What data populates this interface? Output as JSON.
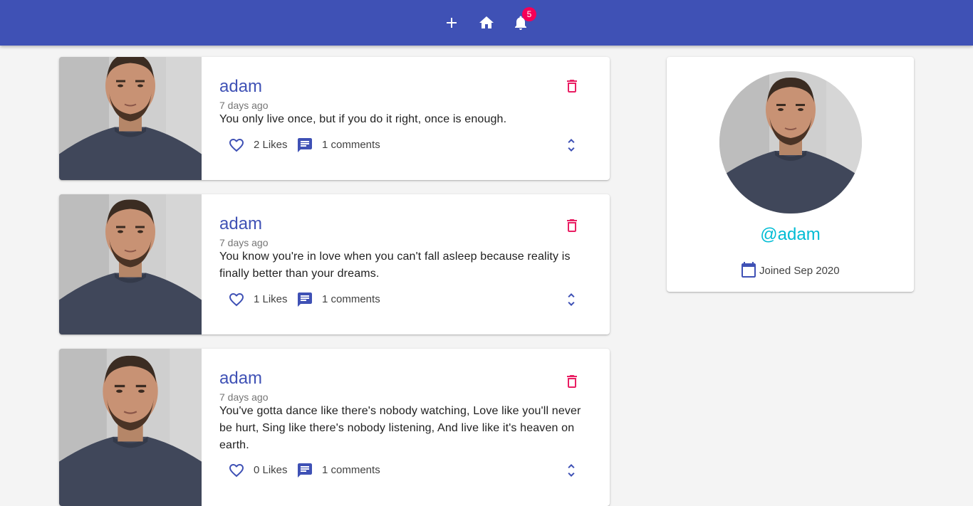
{
  "nav": {
    "buttons": [
      {
        "icon": "add-icon"
      },
      {
        "icon": "home-icon"
      },
      {
        "icon": "notifications-icon"
      }
    ],
    "notification_count": "5"
  },
  "posts": [
    {
      "user": "adam",
      "date": "7 days ago",
      "body": "You only live once, but if you do it right, once is enough.",
      "likes": "2 Likes",
      "comments": "1 comments"
    },
    {
      "user": "adam",
      "date": "7 days ago",
      "body": "You know you're in love when you can't fall asleep because reality is finally better than your dreams.",
      "likes": "1 Likes",
      "comments": "1 comments"
    },
    {
      "user": "adam",
      "date": "7 days ago",
      "body": "You've gotta dance like there's nobody watching, Love like you'll never be hurt, Sing like there's nobody listening, And live like it's heaven on earth.",
      "likes": "0 Likes",
      "comments": "1 comments"
    }
  ],
  "profile": {
    "handle": "@adam",
    "joined": "Joined Sep 2020"
  },
  "colors": {
    "primary": "#3f51b5",
    "secondary": "#f50057",
    "handle": "#00bcd4"
  }
}
